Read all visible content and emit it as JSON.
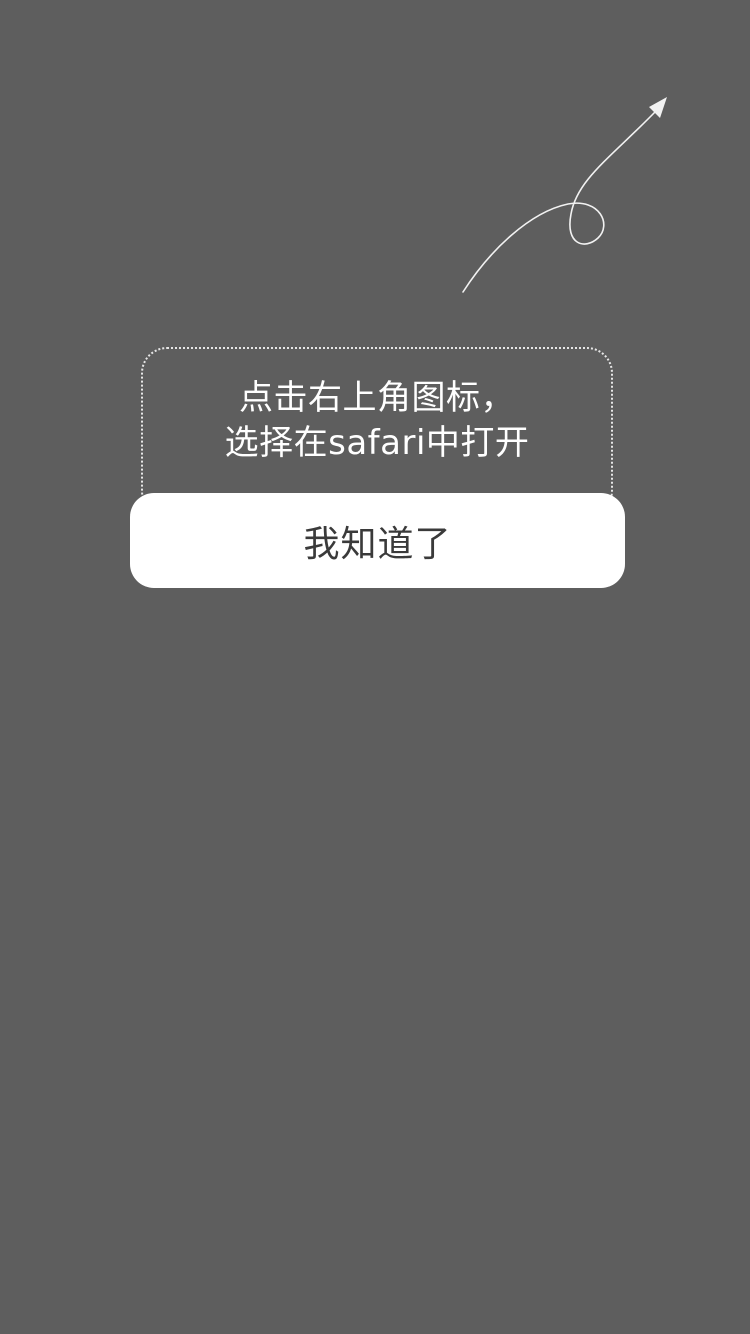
{
  "overlay": {
    "background_color": "#5e5e5e",
    "arrow_icon": "curly-arrow-pointing-top-right"
  },
  "tip": {
    "line1": "点击右上角图标，",
    "line2": "选择在safari中打开"
  },
  "confirm_button": {
    "label": "我知道了"
  }
}
